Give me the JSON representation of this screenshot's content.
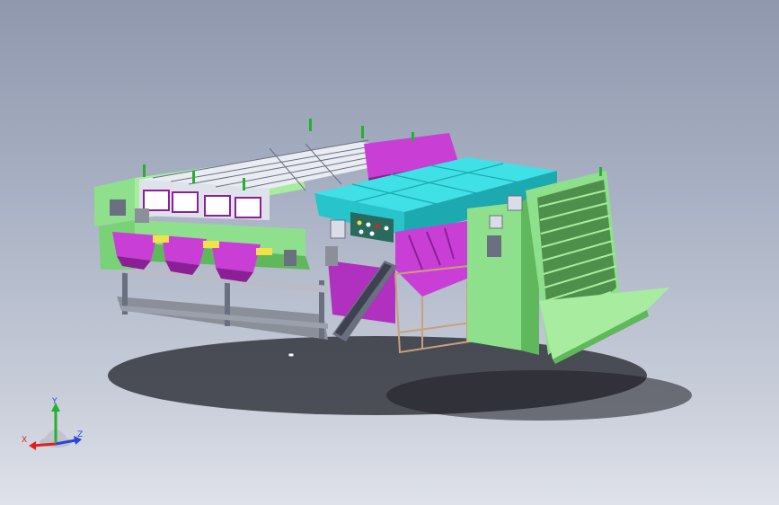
{
  "viewport": {
    "background_top": "#8f98ad",
    "background_bottom": "#dfe2ea"
  },
  "model": {
    "colors": {
      "frame_green": "#8fe08c",
      "frame_green_dark": "#5fb85c",
      "purple": "#c93fd6",
      "purple_dark": "#8a1f96",
      "cyan": "#3fe0e6",
      "cyan_dark": "#1ca9b0",
      "steel": "#d9dde6",
      "steel_dark": "#6b7080",
      "yellow": "#f2e14a",
      "tan": "#c9a07a",
      "shadow": "#1b1c22"
    }
  },
  "axis_triad": {
    "x_label": "X",
    "y_label": "Y",
    "z_label": "Z",
    "x_color": "#e0201e",
    "y_color": "#22b22e",
    "z_color": "#2b45d8"
  }
}
